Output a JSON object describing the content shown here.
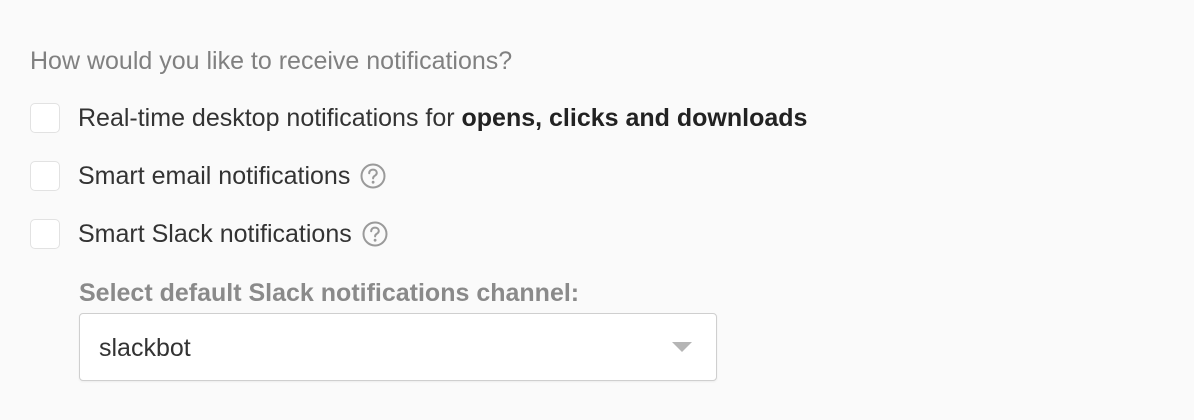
{
  "question": "How would you like to receive notifications?",
  "options": [
    {
      "label_prefix": "Real-time desktop notifications for ",
      "label_bold": "opens, clicks and downloads",
      "checked": false
    },
    {
      "label": "Smart email notifications",
      "help_icon": "question-circle-icon",
      "checked": false
    },
    {
      "label": "Smart Slack notifications",
      "help_icon": "question-circle-icon",
      "checked": false
    }
  ],
  "slack_channel": {
    "label": "Select default Slack notifications channel:",
    "selected": "slackbot",
    "dropdown_icon": "chevron-down-icon"
  },
  "colors": {
    "background": "#fafafa",
    "muted_text": "#808080",
    "text": "#333333",
    "checkbox_border": "#e2e2e2",
    "select_border": "#cfcfcf"
  }
}
